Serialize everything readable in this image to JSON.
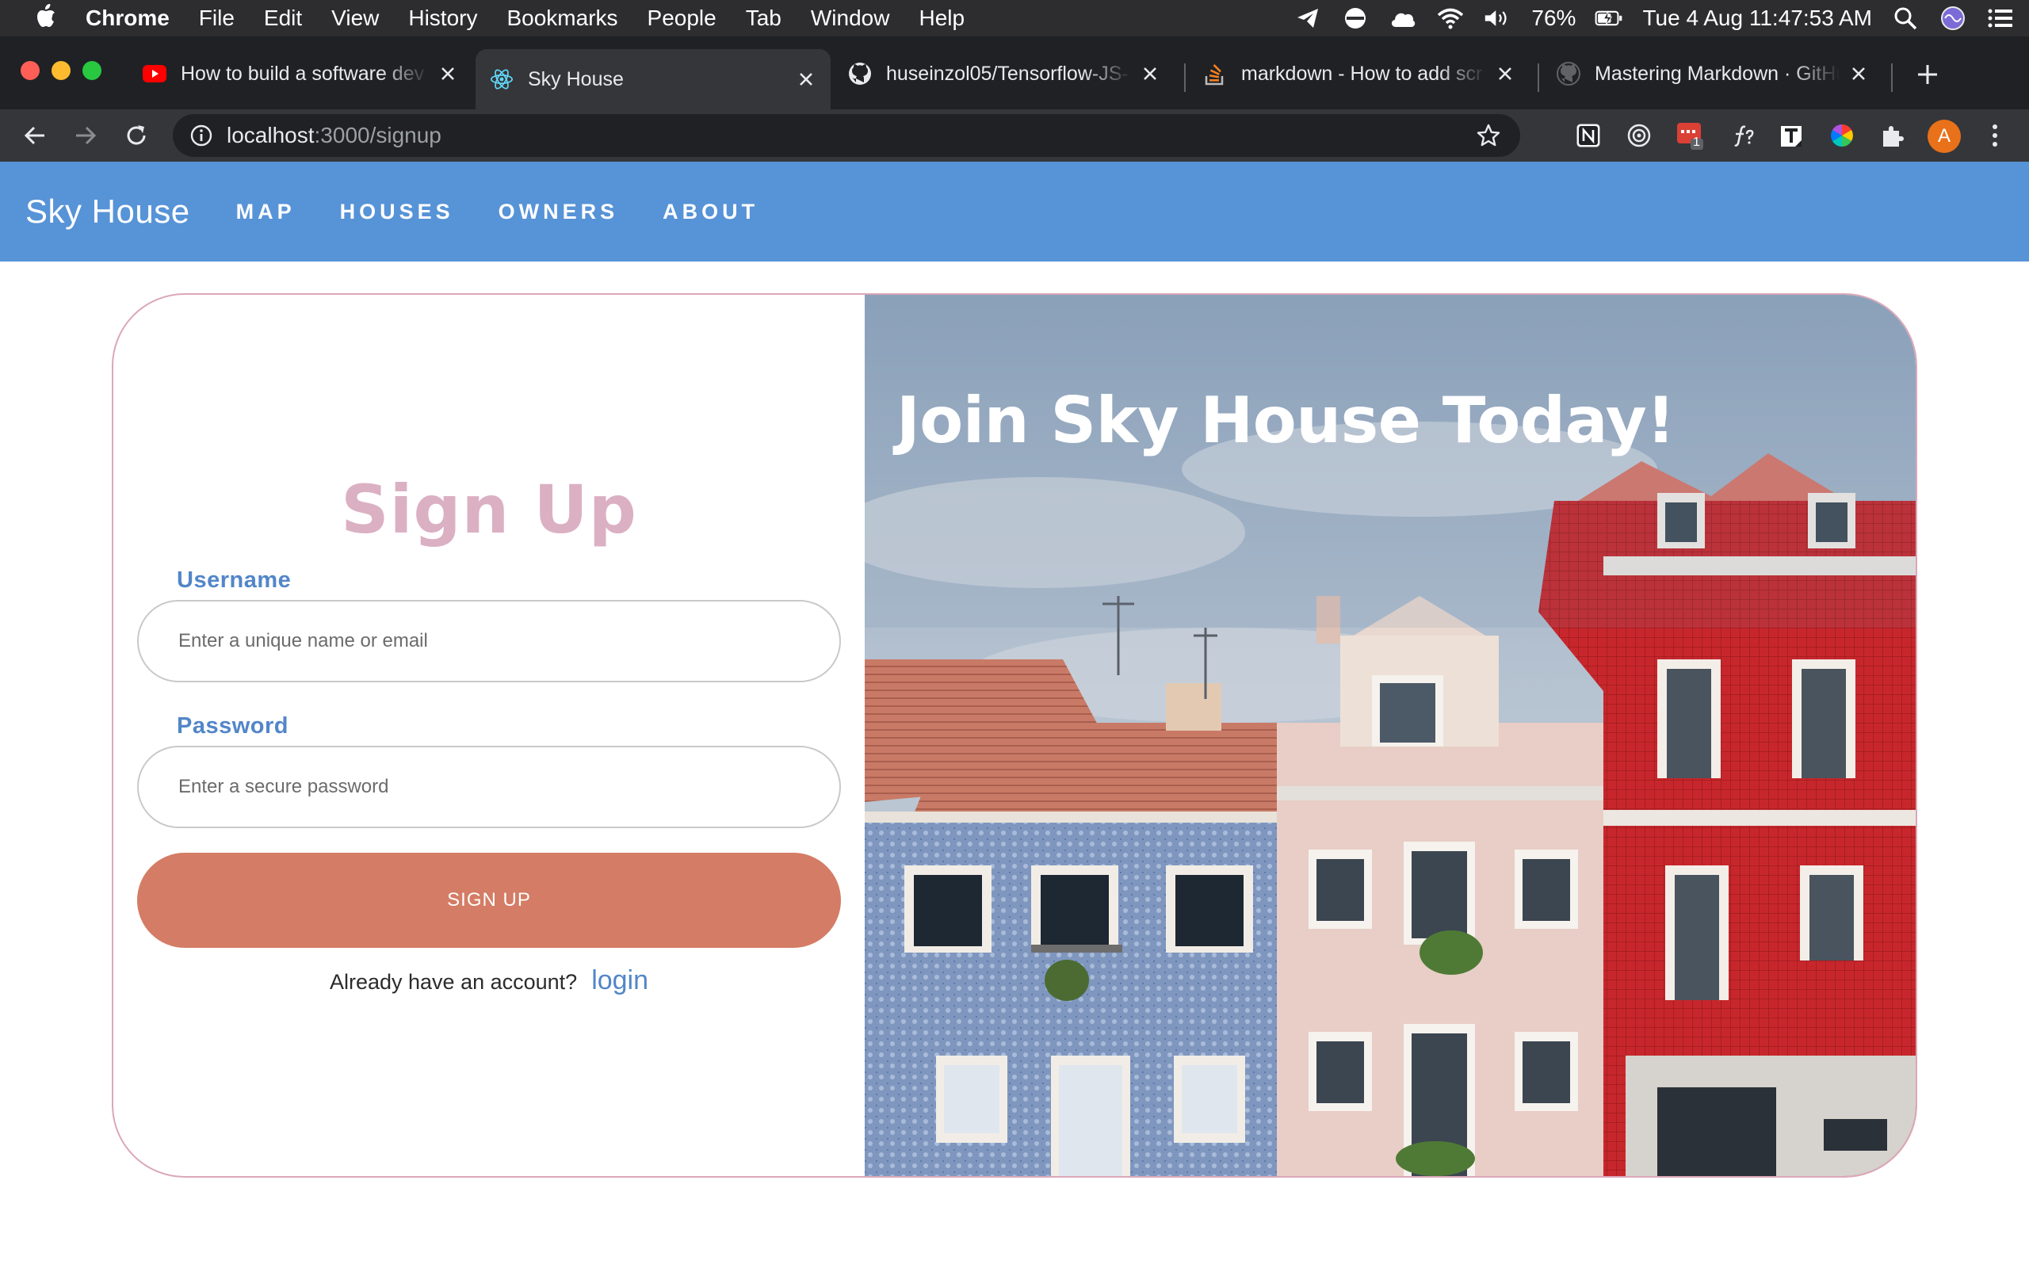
{
  "menubar": {
    "app_name": "Chrome",
    "items": [
      "File",
      "Edit",
      "View",
      "History",
      "Bookmarks",
      "People",
      "Tab",
      "Window",
      "Help"
    ],
    "battery": "76%",
    "datetime": "Tue 4 Aug  11:47:53 AM"
  },
  "tabs": [
    {
      "title": "How to build a software dev",
      "icon": "youtube-icon"
    },
    {
      "title": "Sky House",
      "icon": "react-icon"
    },
    {
      "title": "huseinzol05/Tensorflow-JS-",
      "icon": "github-icon"
    },
    {
      "title": "markdown - How to add scr",
      "icon": "stackoverflow-icon"
    },
    {
      "title": "Mastering Markdown · GitHu",
      "icon": "github-icon"
    }
  ],
  "address_bar": {
    "host": "localhost",
    "path": ":3000/signup"
  },
  "profile_initial": "A",
  "extension_badge": "1",
  "site": {
    "brand": "Sky House",
    "nav": [
      "MAP",
      "HOUSES",
      "OWNERS",
      "ABOUT"
    ]
  },
  "signup": {
    "title": "Sign Up",
    "username_label": "Username",
    "username_placeholder": "Enter a unique name or email",
    "password_label": "Password",
    "password_placeholder": "Enter a secure password",
    "submit_label": "SIGN UP",
    "login_prompt": "Already have an account?",
    "login_link": "login"
  },
  "hero": {
    "title": "Join Sky House Today!"
  },
  "colors": {
    "nav_bg": "#5793d7",
    "title_pink": "#dbb0c3",
    "label_blue": "#5286c8",
    "button": "#d47c65",
    "card_border": "#dba7b8"
  }
}
